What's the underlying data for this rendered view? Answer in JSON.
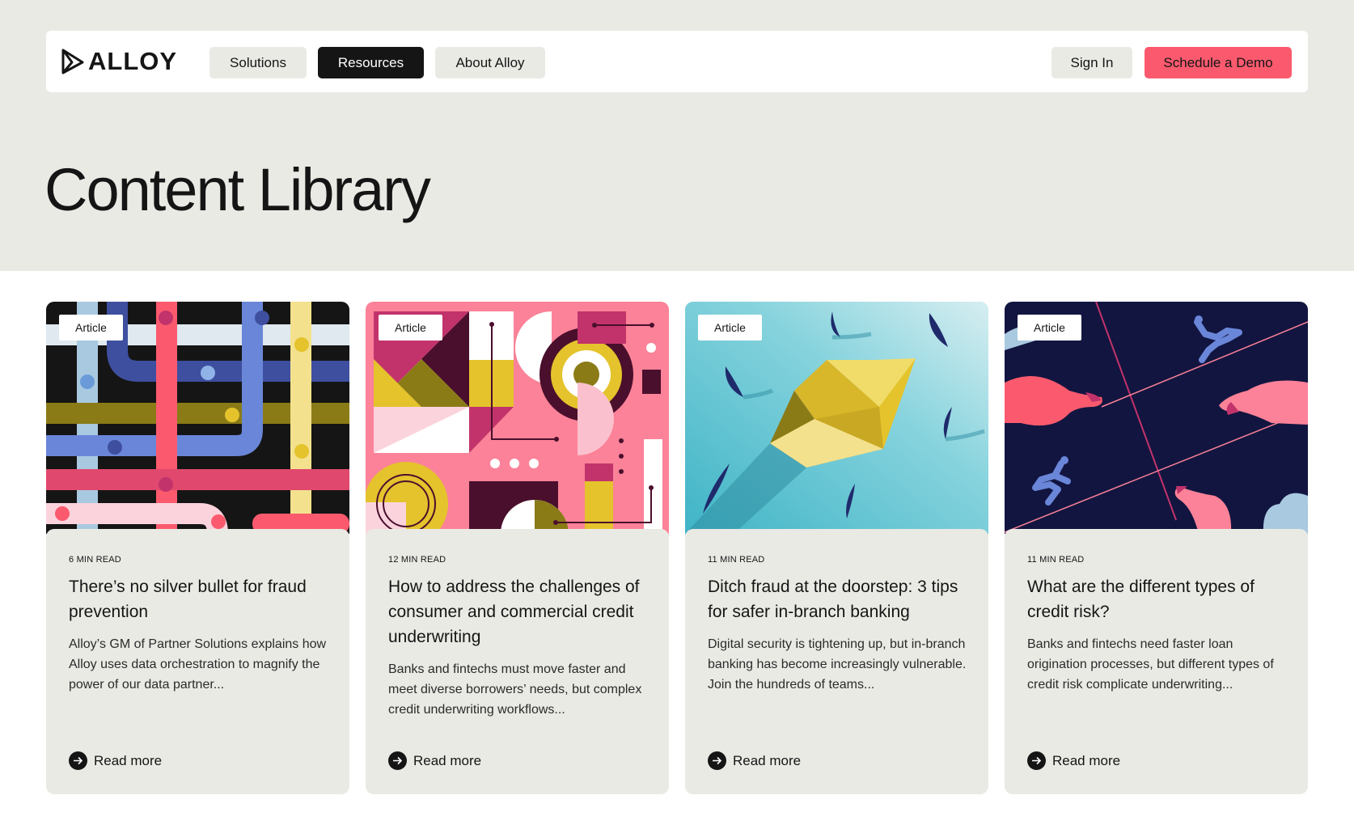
{
  "nav": {
    "logo": "ALLOY",
    "items": [
      "Solutions",
      "Resources",
      "About Alloy"
    ],
    "sign_in": "Sign In",
    "demo": "Schedule a Demo"
  },
  "page": {
    "title": "Content Library"
  },
  "cards": [
    {
      "badge": "Article",
      "read_time": "6 MIN READ",
      "title": "There’s no silver bullet for fraud prevention",
      "description": "Alloy’s GM of Partner Solutions explains how Alloy uses data orchestration to magnify the power of our data partner...",
      "cta": "Read more"
    },
    {
      "badge": "Article",
      "read_time": "12 MIN READ",
      "title": "How to address the challenges of consumer and commercial credit underwriting",
      "description": "Banks and fintechs must move faster and meet diverse borrowers’ needs, but complex credit underwriting workflows...",
      "cta": "Read more"
    },
    {
      "badge": "Article",
      "read_time": "11 MIN READ",
      "title": "Ditch fraud at the doorstep: 3 tips for safer in-branch banking",
      "description": "Digital security is tightening up, but in-branch banking has become increasingly vulnerable. Join the hundreds of teams...",
      "cta": "Read more"
    },
    {
      "badge": "Article",
      "read_time": "11 MIN READ",
      "title": "What are the different types of credit risk?",
      "description": "Banks and fintechs need faster loan origination processes, but different types of credit risk complicate underwriting...",
      "cta": "Read more"
    }
  ],
  "colors": {
    "accent": "#fb5a6e",
    "dark": "#151515",
    "hero_bg": "#eaeae5"
  },
  "icons": {
    "logo": "alloy-logo-icon",
    "arrow": "arrow-right-icon"
  }
}
